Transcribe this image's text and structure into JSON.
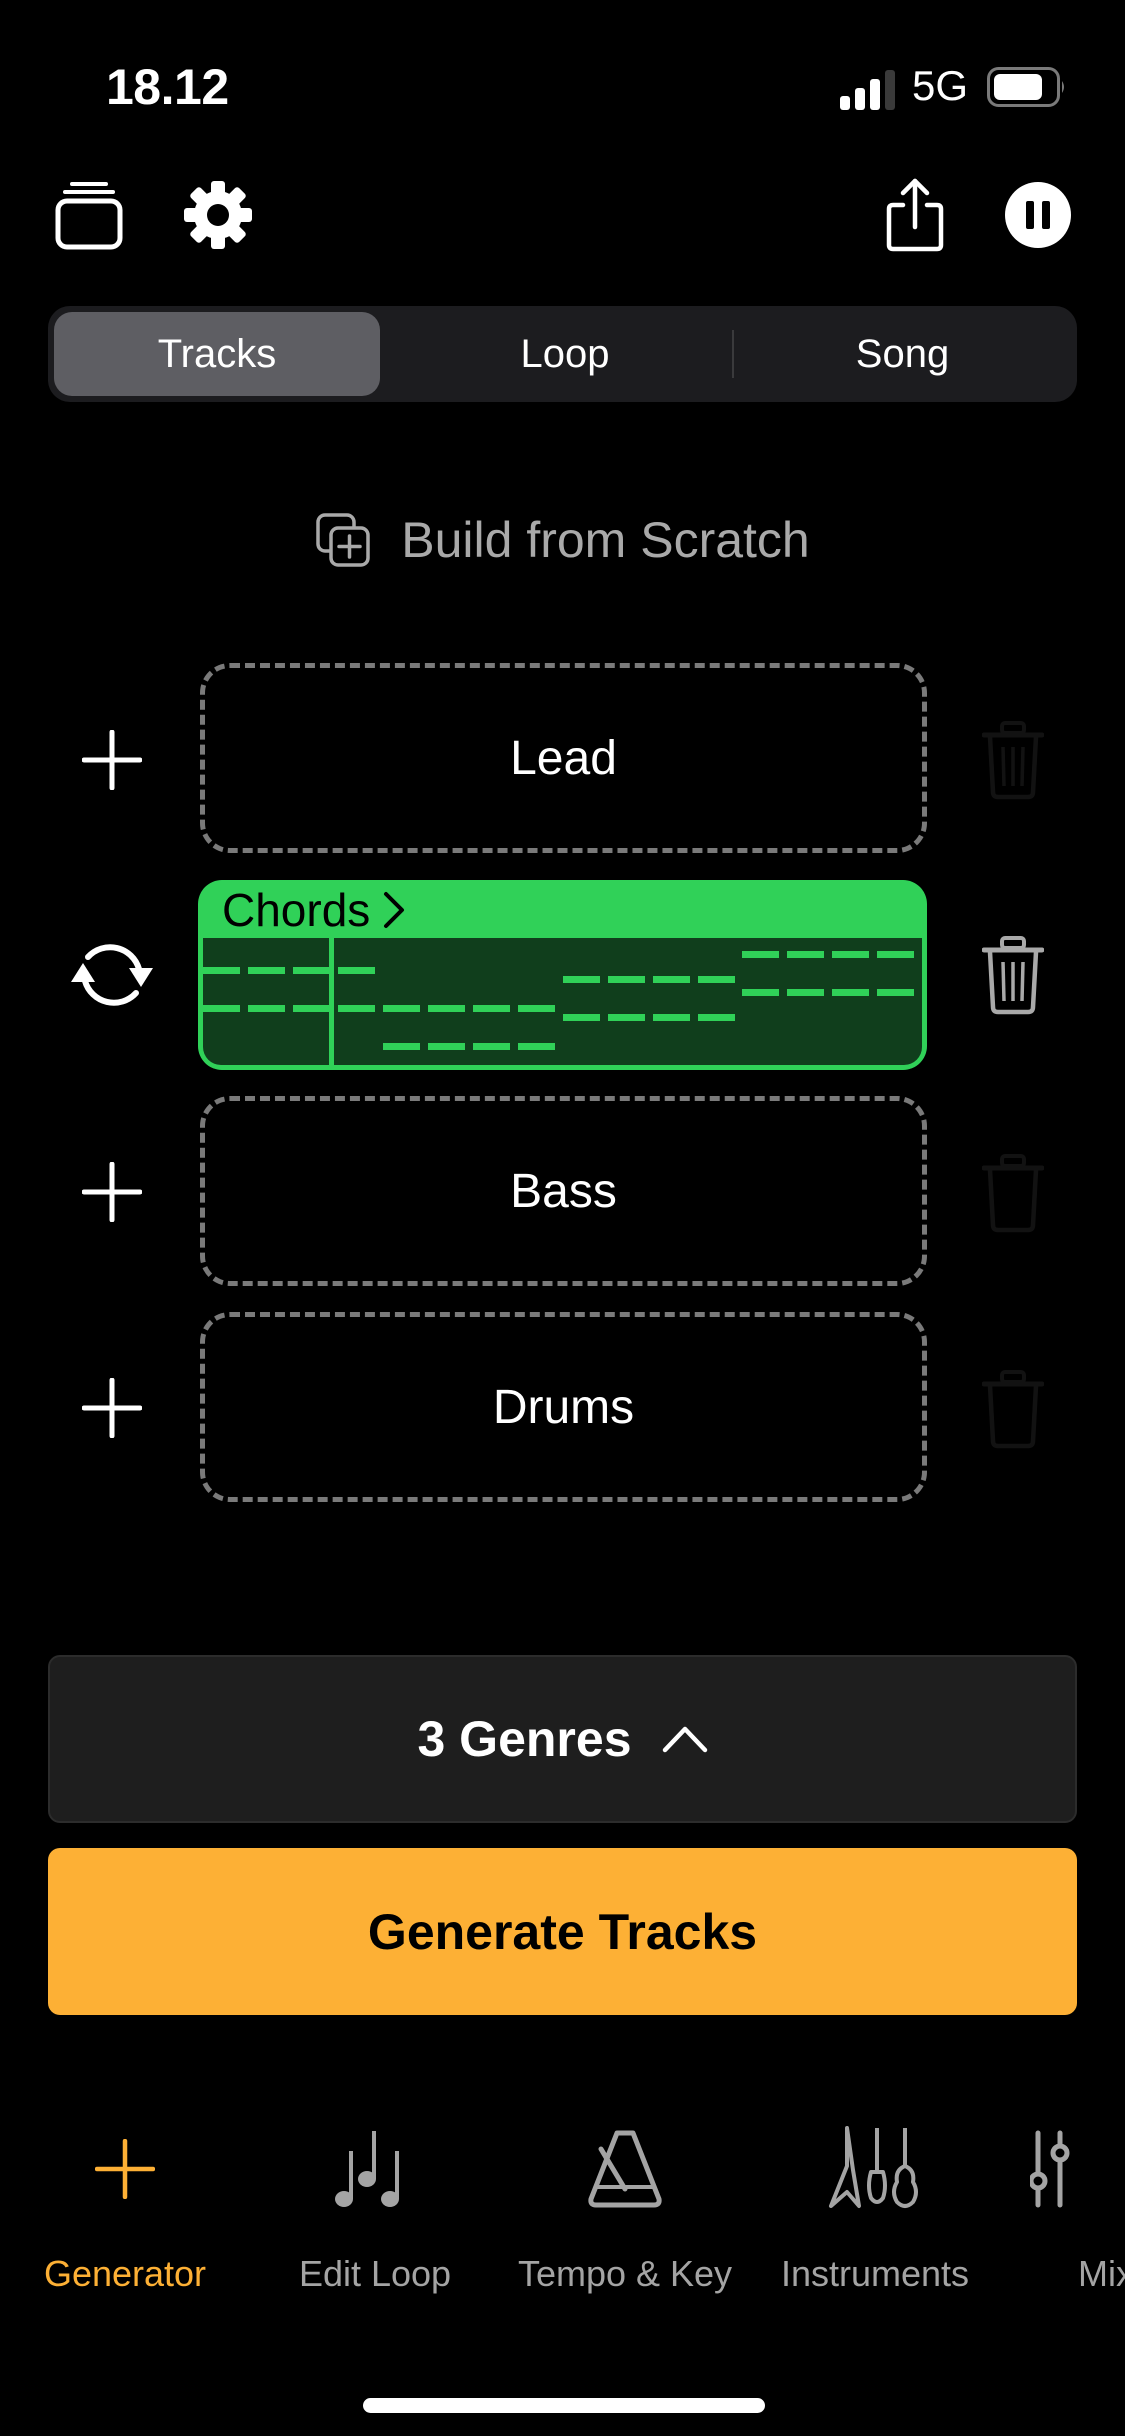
{
  "status_bar": {
    "time": "18.12",
    "network": "5G",
    "signal_bars_active": 3,
    "signal_bars_total": 4,
    "battery_level": 0.8
  },
  "header": {
    "left_icons": [
      "projects-icon",
      "gear-icon"
    ],
    "right_icons": [
      "share-icon",
      "pause-icon"
    ]
  },
  "segmented": {
    "items": [
      "Tracks",
      "Loop",
      "Song"
    ],
    "selected": "Tracks"
  },
  "build_from_scratch": {
    "label": "Build from Scratch",
    "icon": "add-copy-icon"
  },
  "tracks": [
    {
      "name": "Lead",
      "state": "empty",
      "left_icon": "plus-icon"
    },
    {
      "name": "Chords",
      "state": "filled",
      "left_icon": "regenerate-icon",
      "accent": "#30d158"
    },
    {
      "name": "Bass",
      "state": "empty",
      "left_icon": "plus-icon"
    },
    {
      "name": "Drums",
      "state": "empty",
      "left_icon": "plus-icon"
    }
  ],
  "chords_clip": {
    "title": "Chords",
    "steps": 16,
    "pitch_lanes": 10,
    "playhead_step": 2.8,
    "notes": [
      {
        "lane": 2.25,
        "start": 0,
        "end": 4
      },
      {
        "lane": 5.25,
        "start": 0,
        "end": 8
      },
      {
        "lane": 8.25,
        "start": 4,
        "end": 8
      },
      {
        "lane": 3,
        "start": 8,
        "end": 12
      },
      {
        "lane": 6,
        "start": 8,
        "end": 12
      },
      {
        "lane": 1,
        "start": 12,
        "end": 16
      },
      {
        "lane": 4,
        "start": 12,
        "end": 16
      }
    ]
  },
  "genres_button": {
    "label": "3 Genres",
    "icon": "chevron-up-icon"
  },
  "generate_button": {
    "label": "Generate Tracks",
    "color": "#fdb035"
  },
  "tab_bar": {
    "items": [
      {
        "label": "Generator",
        "icon": "plus-icon",
        "active": true
      },
      {
        "label": "Edit Loop",
        "icon": "music-notes-icon",
        "active": false
      },
      {
        "label": "Tempo & Key",
        "icon": "metronome-icon",
        "active": false
      },
      {
        "label": "Instruments",
        "icon": "guitars-icon",
        "active": false
      },
      {
        "label": "Mixer",
        "icon": "sliders-icon",
        "active": false
      }
    ]
  },
  "colors": {
    "accent": "#fdb035",
    "track_green": "#30d158"
  }
}
